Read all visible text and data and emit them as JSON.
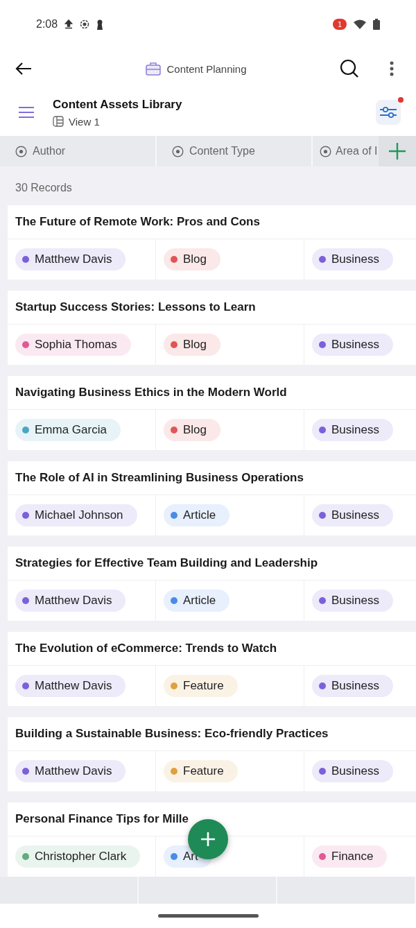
{
  "status_bar": {
    "time": "2:08",
    "notification_count": "1"
  },
  "app_bar": {
    "title": "Content Planning"
  },
  "table_header": {
    "title": "Content Assets Library",
    "view": "View 1",
    "filter_active": true
  },
  "columns": [
    "Author",
    "Content Type",
    "Area of I"
  ],
  "record_count": "30 Records",
  "records": [
    {
      "title": "The Future of Remote Work: Pros and Cons",
      "tags": [
        {
          "label": "Matthew Davis",
          "color": "#7b61d9"
        },
        {
          "label": "Blog",
          "color": "#e05555"
        },
        {
          "label": "Business",
          "color": "#7b61d9"
        }
      ]
    },
    {
      "title": "Startup Success Stories: Lessons to Learn",
      "tags": [
        {
          "label": "Sophia Thomas",
          "color": "#e05a94"
        },
        {
          "label": "Blog",
          "color": "#e05555"
        },
        {
          "label": "Business",
          "color": "#7b61d9"
        }
      ]
    },
    {
      "title": "Navigating Business Ethics in the Modern World",
      "tags": [
        {
          "label": "Emma Garcia",
          "color": "#4aa7c0"
        },
        {
          "label": "Blog",
          "color": "#e05555"
        },
        {
          "label": "Business",
          "color": "#7b61d9"
        }
      ]
    },
    {
      "title": "The Role of AI in Streamlining Business Operations",
      "tags": [
        {
          "label": "Michael Johnson",
          "color": "#7b61d9"
        },
        {
          "label": "Article",
          "color": "#4a8be8"
        },
        {
          "label": "Business",
          "color": "#7b61d9"
        }
      ]
    },
    {
      "title": "Strategies for Effective Team Building and Leadership",
      "tags": [
        {
          "label": "Matthew Davis",
          "color": "#7b61d9"
        },
        {
          "label": "Article",
          "color": "#4a8be8"
        },
        {
          "label": "Business",
          "color": "#7b61d9"
        }
      ]
    },
    {
      "title": "The Evolution of eCommerce: Trends to Watch",
      "tags": [
        {
          "label": "Matthew Davis",
          "color": "#7b61d9"
        },
        {
          "label": "Feature",
          "color": "#e0a040"
        },
        {
          "label": "Business",
          "color": "#7b61d9"
        }
      ]
    },
    {
      "title": "Building a Sustainable Business: Eco-friendly Practices",
      "tags": [
        {
          "label": "Matthew Davis",
          "color": "#7b61d9"
        },
        {
          "label": "Feature",
          "color": "#e0a040"
        },
        {
          "label": "Business",
          "color": "#7b61d9"
        }
      ]
    },
    {
      "title": "Personal Finance Tips for Mille",
      "tags": [
        {
          "label": "Christopher Clark",
          "color": "#5fae7e"
        },
        {
          "label": "Art",
          "color": "#4a8be8"
        },
        {
          "label": "Finance",
          "color": "#e05a94"
        }
      ]
    }
  ]
}
